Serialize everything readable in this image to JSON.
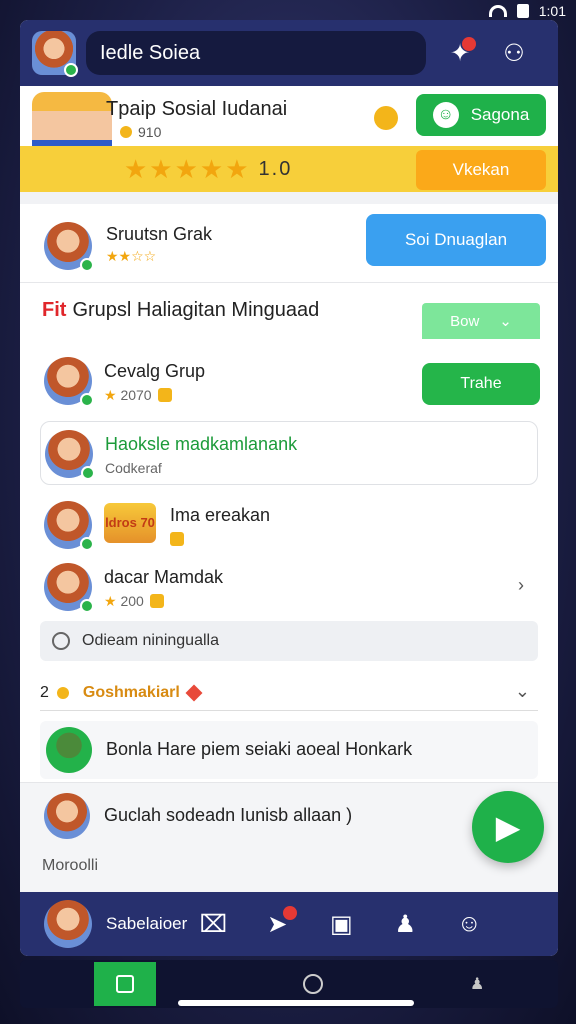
{
  "status": {
    "time": "1:01"
  },
  "topbar": {
    "title": "Iedle Soiea"
  },
  "hero": {
    "title": "Tpaip Sosial Iudanai",
    "coins": "910",
    "btn_green": "Sagona",
    "rating": "1.0",
    "btn_orange": "Vkekan"
  },
  "user_card": {
    "name": "Sruutsn Grak",
    "button": "Soi Dnuaglan"
  },
  "section": {
    "prefix": "Fit",
    "title": "Grupsl Haliagitan Minguaad",
    "dropdown": "Bow",
    "trade_button": "Trahe"
  },
  "rows": [
    {
      "name": "Cevalg Grup",
      "sub": "2070"
    },
    {
      "name": "Haoksle madkamlanank",
      "sub": "Codkeraf"
    },
    {
      "name": "Ima ereakan",
      "badge": "ldros 70"
    },
    {
      "name": "dacar Mamdak",
      "sub": "200"
    }
  ],
  "search": {
    "text": "Odieam niningualla"
  },
  "group": {
    "num": "2",
    "name": "Goshmakiarl"
  },
  "post": {
    "text": "Bonla Hare piem seiaki aoeal Honkark"
  },
  "chat": {
    "message": "Guclah sodeadn Iunisb allaan )",
    "more": "Moroolli"
  },
  "bottom_nav": {
    "label": "Sabelaioer"
  },
  "colors": {
    "primary": "#27306e",
    "green": "#1fb14a",
    "yellow": "#f7cf3a",
    "blue": "#3aa0f0"
  }
}
